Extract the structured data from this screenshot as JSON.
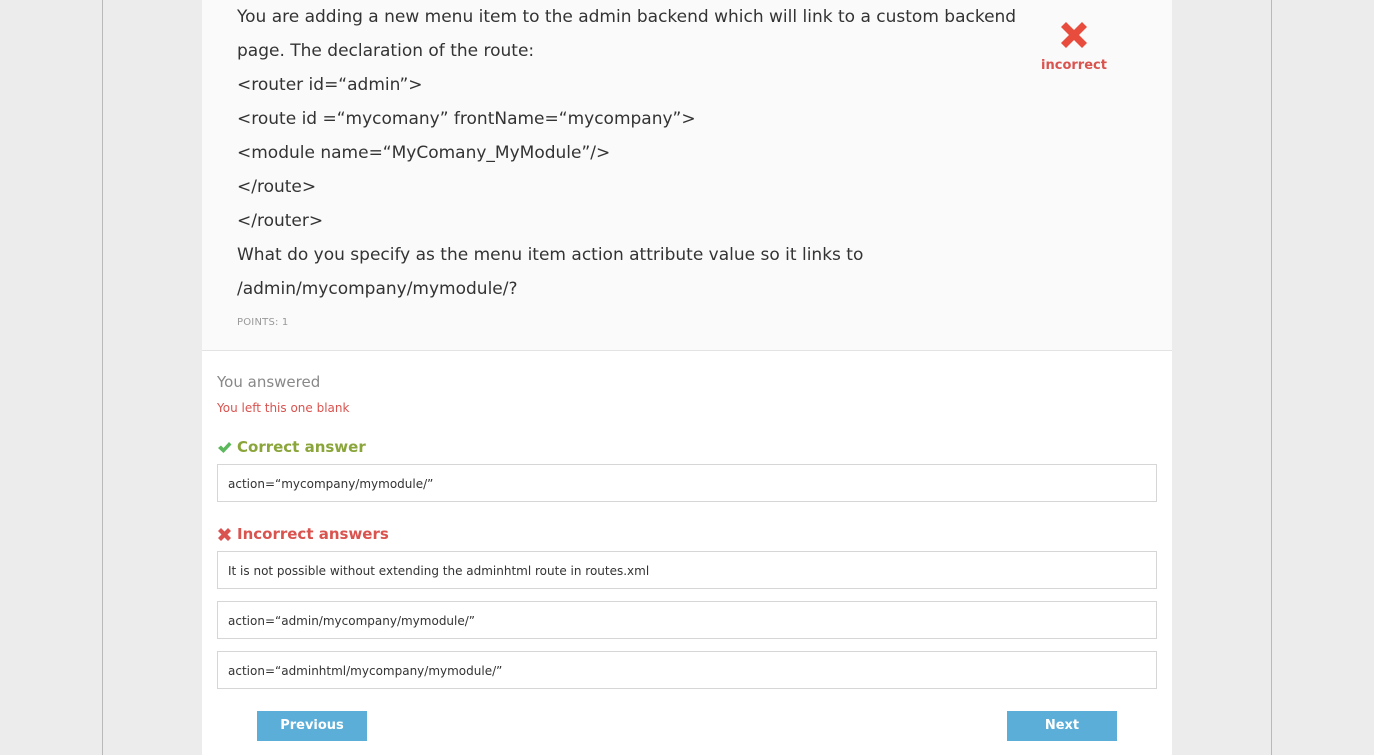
{
  "question": {
    "lines": [
      "You are adding a new menu item to the admin backend which will link to a custom backend",
      "page. The declaration of the route:",
      "<router id=“admin”>",
      "<route id =“mycomany” frontName=“mycompany”>",
      "<module name=“MyComany_MyModule”/>",
      "</route>",
      "</router>",
      "What do you specify as the menu item action attribute value so it links to",
      "/admin/mycompany/mymodule/?"
    ],
    "points": "POINTS: 1"
  },
  "status": {
    "label": "incorrect",
    "icon": "x-icon",
    "color": "#e74c3c"
  },
  "response": {
    "heading": "You answered",
    "note": "You left this one blank"
  },
  "correct": {
    "heading": "Correct answer",
    "icon": "check-icon",
    "answers": [
      "action=“mycompany/mymodule/”"
    ]
  },
  "incorrect": {
    "heading": "Incorrect answers",
    "icon": "x-icon",
    "answers": [
      "It is not possible without extending the adminhtml route in routes.xml",
      "action=“admin/mycompany/mymodule/”",
      "action=“adminhtml/mycompany/mymodule/”"
    ]
  },
  "nav": {
    "previous": "Previous",
    "next": "Next",
    "accent": "#5aaed8"
  }
}
